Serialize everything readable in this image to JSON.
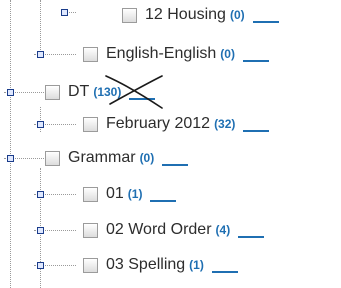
{
  "tree": {
    "items": [
      {
        "label": "12 Housing",
        "count": "(0)"
      },
      {
        "label": "English-English",
        "count": "(0)"
      },
      {
        "label": "DT",
        "count": "(130)"
      },
      {
        "label": "February 2012",
        "count": "(32)"
      },
      {
        "label": "Grammar",
        "count": "(0)"
      },
      {
        "label": "01",
        "count": "(1)"
      },
      {
        "label": "02 Word Order",
        "count": "(4)"
      },
      {
        "label": "03 Spelling",
        "count": "(1)"
      }
    ]
  },
  "colors": {
    "count_text": "#1f6fb2",
    "link_line": "#1f6fb2",
    "node_border": "#1a3c8a"
  }
}
